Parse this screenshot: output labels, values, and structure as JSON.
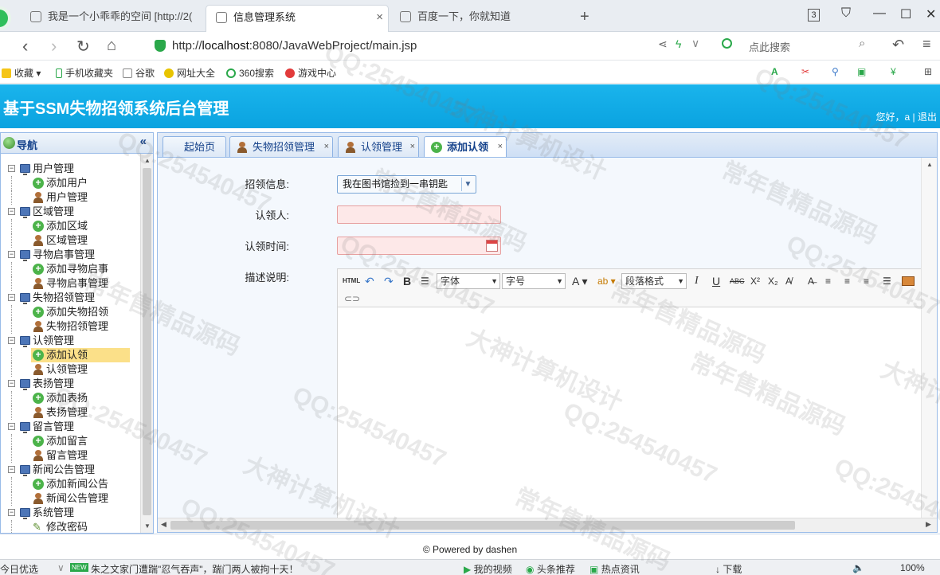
{
  "browser": {
    "tabs": [
      {
        "title": "我是一个小乖乖的空间 [http://2("
      },
      {
        "title": "信息管理系统"
      },
      {
        "title": "百度一下，你就知道"
      }
    ],
    "tab_count": "3",
    "url_prefix": "http://",
    "url_host": "localhost",
    "url_rest": ":8080/JavaWebProject/main.jsp",
    "search_placeholder": "点此搜索",
    "bookmarks": [
      "收藏",
      "手机收藏夹",
      "谷歌",
      "网址大全",
      "360搜索",
      "游戏中心"
    ]
  },
  "app": {
    "title": "基于SSM失物招领系统后台管理",
    "user_greeting": "您好，a",
    "separator": "|",
    "logout": "退出"
  },
  "sidebar": {
    "header": "导航",
    "collapse_icon": "«",
    "groups": [
      {
        "label": "用户管理",
        "children": [
          "添加用户",
          "用户管理"
        ]
      },
      {
        "label": "区域管理",
        "children": [
          "添加区域",
          "区域管理"
        ]
      },
      {
        "label": "寻物启事管理",
        "children": [
          "添加寻物启事",
          "寻物启事管理"
        ]
      },
      {
        "label": "失物招领管理",
        "children": [
          "添加失物招领",
          "失物招领管理"
        ]
      },
      {
        "label": "认领管理",
        "children": [
          "添加认领",
          "认领管理"
        ]
      },
      {
        "label": "表扬管理",
        "children": [
          "添加表扬",
          "表扬管理"
        ]
      },
      {
        "label": "留言管理",
        "children": [
          "添加留言",
          "留言管理"
        ]
      },
      {
        "label": "新闻公告管理",
        "children": [
          "添加新闻公告",
          "新闻公告管理"
        ]
      },
      {
        "label": "系统管理",
        "children": [
          "修改密码"
        ]
      }
    ]
  },
  "content_tabs": [
    {
      "label": "起始页"
    },
    {
      "label": "失物招领管理"
    },
    {
      "label": "认领管理"
    },
    {
      "label": "添加认领"
    }
  ],
  "form": {
    "claim_info_label": "招领信息:",
    "claim_info_value": "我在图书馆捡到一串钥匙",
    "claimant_label": "认领人:",
    "claim_time_label": "认领时间:",
    "description_label": "描述说明:"
  },
  "editor": {
    "html_btn": "HTML",
    "bold": "B",
    "font_family": "字体",
    "font_size": "字号",
    "font_color": "A",
    "paragraph": "段落格式",
    "italic": "I",
    "underline": "U",
    "strike": "ABC",
    "sup": "X²",
    "sub": "X₂"
  },
  "footer": {
    "text": "© Powered by dashen"
  },
  "statusbar": {
    "left": "今日优选",
    "news_badge": "NEW",
    "news": "朱之文家门遭踹\"忍气吞声\"，踹门两人被拘十天！",
    "my_video": "我的视频",
    "headlines": "头条推荐",
    "hot_news": "热点资讯",
    "download": "下载",
    "zoom": "100%"
  },
  "watermarks": [
    "QQ:254540457",
    "常年售精品源码",
    "大神计算机设计"
  ]
}
